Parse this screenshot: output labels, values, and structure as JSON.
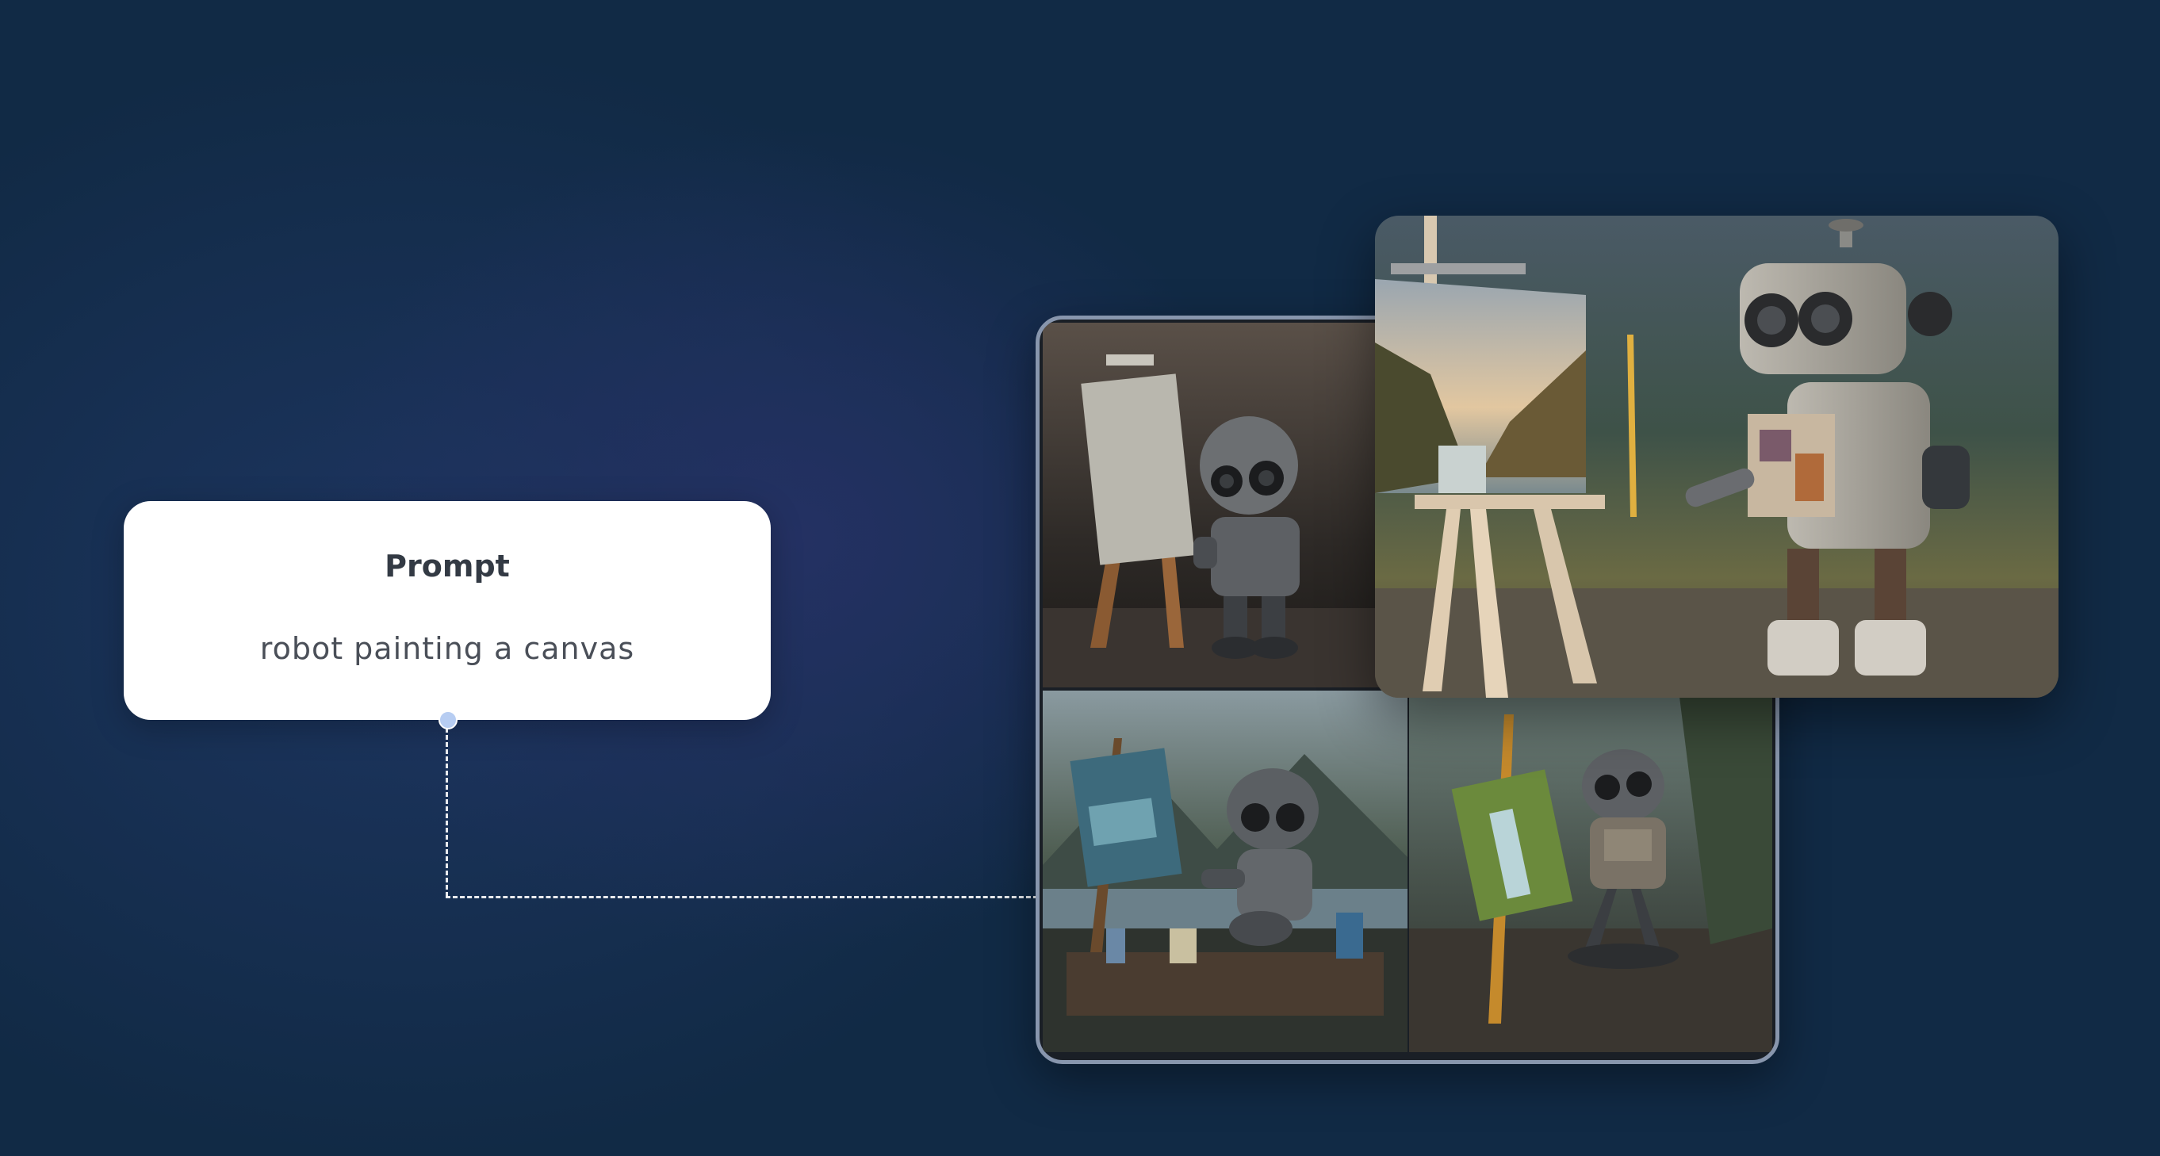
{
  "prompt_card": {
    "title": "Prompt",
    "text": "robot painting a canvas"
  },
  "images": {
    "large": "robot-painting-landscape-large",
    "grid": [
      "robot-painting-easel-dark",
      "robot-painting-lake",
      "robot-painting-waterfall"
    ]
  },
  "colors": {
    "background": "#112a45",
    "card": "#ffffff",
    "frame_border": "#8896ad",
    "connector_dot": "#b7cdf2"
  }
}
